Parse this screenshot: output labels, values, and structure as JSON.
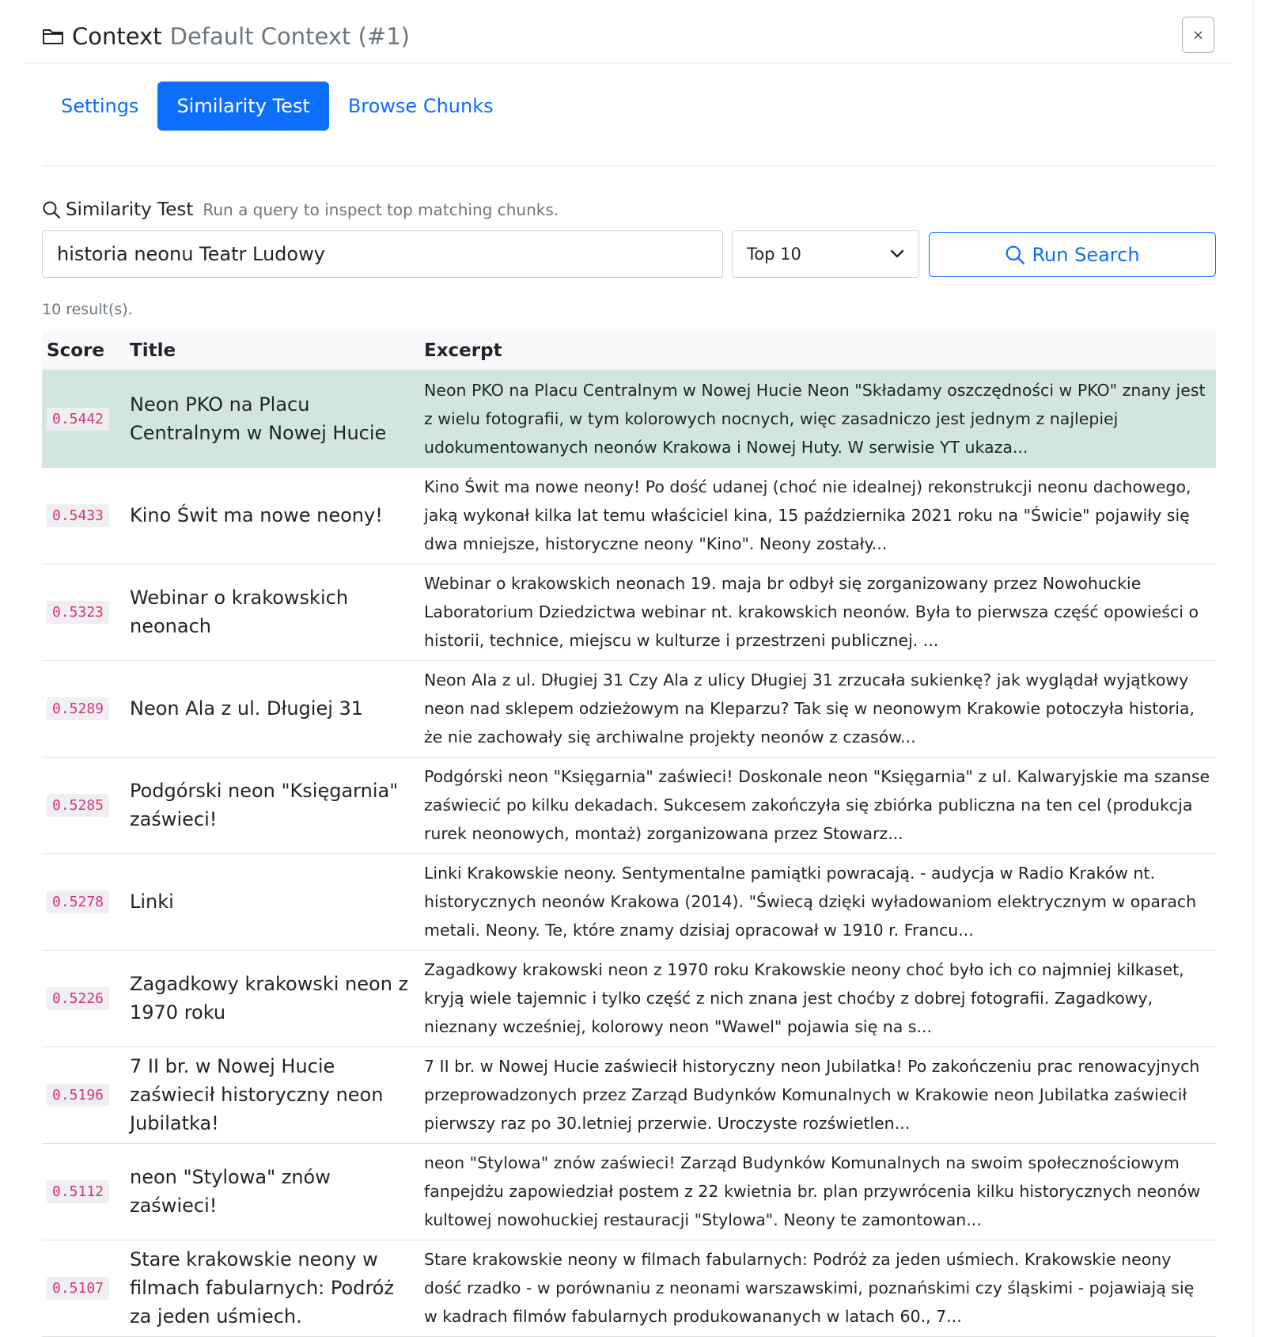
{
  "header": {
    "title": "Context",
    "context_name": "Default Context (#1)",
    "close_label": "×"
  },
  "tabs": [
    {
      "label": "Settings",
      "active": false
    },
    {
      "label": "Similarity Test",
      "active": true
    },
    {
      "label": "Browse Chunks",
      "active": false
    }
  ],
  "section": {
    "title": "Similarity Test",
    "hint": "Run a query to inspect top matching chunks."
  },
  "search": {
    "query": "historia neonu Teatr Ludowy",
    "topk_selected": "Top 10",
    "run_label": "Run Search"
  },
  "result_count": "10 result(s).",
  "table": {
    "headers": {
      "score": "Score",
      "title": "Title",
      "excerpt": "Excerpt"
    },
    "rows": [
      {
        "score": "0.5442",
        "title": "Neon PKO na Placu Centralnym w Nowej Hucie",
        "excerpt": "Neon PKO na Placu Centralnym w Nowej Hucie Neon \"Składamy oszczędności w PKO\" znany jest z wielu fotografii, w tym kolorowych nocnych, więc zasadniczo jest jednym z najlepiej udokumentowanych neonów Krakowa i Nowej Huty. W serwisie YT ukaza..."
      },
      {
        "score": "0.5433",
        "title": "Kino Świt ma nowe neony!",
        "excerpt": "Kino Świt ma nowe neony! Po dość udanej (choć nie idealnej) rekonstrukcji neonu dachowego, jaką wykonał kilka lat temu właściciel kina, 15 października 2021 roku na \"Świcie\" pojawiły się dwa mniejsze, historyczne neony \"Kino\". Neony zostały..."
      },
      {
        "score": "0.5323",
        "title": "Webinar o krakowskich neonach",
        "excerpt": "Webinar o krakowskich neonach 19. maja br odbył się zorganizowany przez Nowohuckie Laboratorium Dziedzictwa webinar nt. krakowskich neonów. Była to pierwsza część opowieści o historii, technice, miejscu w kulturze i przestrzeni publicznej. ..."
      },
      {
        "score": "0.5289",
        "title": "Neon Ala z ul. Długiej 31",
        "excerpt": "Neon Ala z ul. Długiej 31 Czy Ala z ulicy Długiej 31 zrzucała sukienkę? jak wyglądał wyjątkowy neon nad sklepem odzieżowym na Kleparzu? Tak się w neonowym Krakowie potoczyła historia, że nie zachowały się archiwalne projekty neonów z czasów..."
      },
      {
        "score": "0.5285",
        "title": "Podgórski neon \"Księgarnia\" zaświeci!",
        "excerpt": "Podgórski neon \"Księgarnia\" zaświeci! Doskonale neon \"Księgarnia\" z ul. Kalwaryjskie ma szanse zaświecić po kilku dekadach. Sukcesem zakończyła się zbiórka publiczna na ten cel (produkcja rurek neonowych, montaż) zorganizowana przez Stowarz..."
      },
      {
        "score": "0.5278",
        "title": "Linki",
        "excerpt": "Linki Krakowskie neony. Sentymentalne pamiątki powracają. - audycja w Radio Kraków nt. historycznych neonów Krakowa (2014). \"Świecą dzięki wyładowaniom elektrycznym w oparach metali. Neony. Te, które znamy dzisiaj opracował w 1910 r. Francu..."
      },
      {
        "score": "0.5226",
        "title": "Zagadkowy krakowski neon z 1970 roku",
        "excerpt": "Zagadkowy krakowski neon z 1970 roku Krakowskie neony choć było ich co najmniej kilkaset, kryją wiele tajemnic i tylko część z nich znana jest choćby z dobrej fotografii. Zagadkowy, nieznany wcześniej, kolorowy neon \"Wawel\" pojawia się na s..."
      },
      {
        "score": "0.5196",
        "title": "7 II br. w Nowej Hucie zaświecił historyczny neon Jubilatka!",
        "excerpt": "7 II br. w Nowej Hucie zaświecił historyczny neon Jubilatka! Po zakończeniu prac renowacyjnych przeprowadzonych przez Zarząd Budynków Komunalnych w Krakowie neon Jubilatka zaświecił pierwszy raz po 30.letniej przerwie. Uroczyste rozświetlen..."
      },
      {
        "score": "0.5112",
        "title": "neon \"Stylowa\" znów zaświeci!",
        "excerpt": "neon \"Stylowa\" znów zaświeci! Zarząd Budynków Komunalnych na swoim społecznościowym fanpejdżu zapowiedział postem z 22 kwietnia br. plan przywrócenia kilku historycznych neonów kultowej nowohuckiej restauracji \"Stylowa\". Neony te zamontowan..."
      },
      {
        "score": "0.5107",
        "title": "Stare krakowskie neony w filmach fabularnych: Podróż za jeden uśmiech.",
        "excerpt": "Stare krakowskie neony w filmach fabularnych: Podróż za jeden uśmiech. Krakowskie neony dość rzadko - w porównaniu z neonami warszawskimi, poznańskimi czy śląskimi - pojawiają się w kadrach filmów fabularnych produkowananych w latach 60., 7..."
      }
    ]
  },
  "colors": {
    "primary": "#0d6efd",
    "highlight_row": "#d1e7dd",
    "score_text": "#d63384",
    "muted": "#6c757d"
  },
  "icons": [
    "folder-icon",
    "search-icon",
    "chevron-down-icon",
    "close-icon"
  ]
}
